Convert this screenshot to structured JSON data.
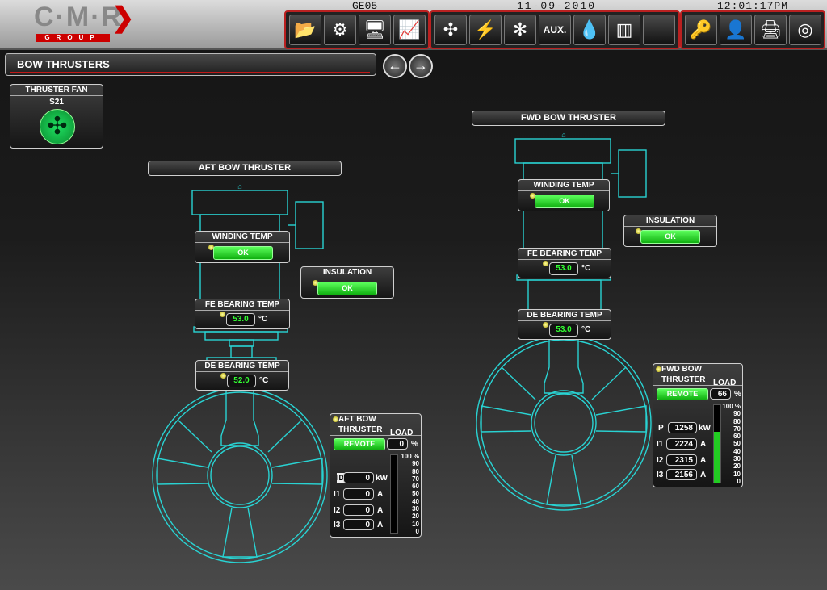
{
  "header": {
    "logo_text": "C·M·R",
    "logo_subtext": "GROUP",
    "station": "GE05",
    "date": "11-09-2010",
    "time": "12:01:17PM"
  },
  "toolbar": {
    "group1": [
      {
        "name": "folder-icon",
        "glyph": "📂"
      },
      {
        "name": "gears-icon",
        "glyph": "⚙"
      },
      {
        "name": "monitor-icon",
        "glyph": "🖥"
      },
      {
        "name": "trend-icon",
        "glyph": "📈"
      }
    ],
    "group2": [
      {
        "name": "propeller-icon",
        "glyph": "✣"
      },
      {
        "name": "lightning-icon",
        "glyph": "⚡"
      },
      {
        "name": "fan-icon",
        "glyph": "✻"
      },
      {
        "name": "aux-button",
        "label": "AUX."
      },
      {
        "name": "water-drop-icon",
        "glyph": "💧"
      },
      {
        "name": "tank-icon",
        "glyph": "▥"
      },
      {
        "name": "blank-button",
        "glyph": ""
      }
    ],
    "group3": [
      {
        "name": "key-icon",
        "glyph": "🔑"
      },
      {
        "name": "user-icon",
        "glyph": "👤"
      },
      {
        "name": "printer-icon",
        "glyph": "🖨"
      },
      {
        "name": "lifebuoy-icon",
        "glyph": "◎"
      }
    ]
  },
  "page": {
    "title": "BOW THRUSTERS",
    "nav_back": "←",
    "nav_forward": "→"
  },
  "thruster_fan": {
    "title": "THRUSTER FAN",
    "id": "S21"
  },
  "aft": {
    "label": "AFT BOW THRUSTER",
    "winding_temp": {
      "title": "WINDING TEMP",
      "status": "OK"
    },
    "insulation": {
      "title": "INSULATION",
      "status": "OK"
    },
    "fe_bearing": {
      "title": "FE BEARING TEMP",
      "value": "53.0",
      "unit": "°C"
    },
    "de_bearing": {
      "title": "DE BEARING TEMP",
      "value": "52.0",
      "unit": "°C"
    },
    "status_panel": {
      "title": "AFT BOW THRUSTER",
      "mode": "REMOTE",
      "load_label": "LOAD",
      "load_value": "0",
      "load_unit": "%",
      "p_label": "ID:",
      "p_value": "0",
      "p_unit": "kW",
      "i1_label": "I1",
      "i1_value": "0",
      "i2_label": "I2",
      "i2_value": "0",
      "i3_label": "I3",
      "i3_value": "0",
      "current_unit": "A",
      "load_fraction": 0
    }
  },
  "fwd": {
    "label": "FWD BOW THRUSTER",
    "winding_temp": {
      "title": "WINDING TEMP",
      "status": "OK"
    },
    "insulation": {
      "title": "INSULATION",
      "status": "OK"
    },
    "fe_bearing": {
      "title": "FE BEARING TEMP",
      "value": "53.0",
      "unit": "°C"
    },
    "de_bearing": {
      "title": "DE BEARING TEMP",
      "value": "53.0",
      "unit": "°C"
    },
    "status_panel": {
      "title": "FWD BOW THRUSTER",
      "mode": "REMOTE",
      "load_label": "LOAD",
      "load_value": "66",
      "load_unit": "%",
      "p_label": "P",
      "p_value": "1258",
      "p_unit": "kW",
      "i1_label": "I1",
      "i1_value": "2224",
      "i2_label": "I2",
      "i2_value": "2315",
      "i3_label": "I3",
      "i3_value": "2156",
      "current_unit": "A",
      "load_fraction": 0.66
    }
  },
  "load_scale": [
    "100 %",
    "90",
    "80",
    "70",
    "60",
    "50",
    "40",
    "30",
    "20",
    "10",
    "0"
  ],
  "colors": {
    "accent": "#c01818",
    "ok": "#22cc22",
    "drawing": "#29d3d3"
  }
}
